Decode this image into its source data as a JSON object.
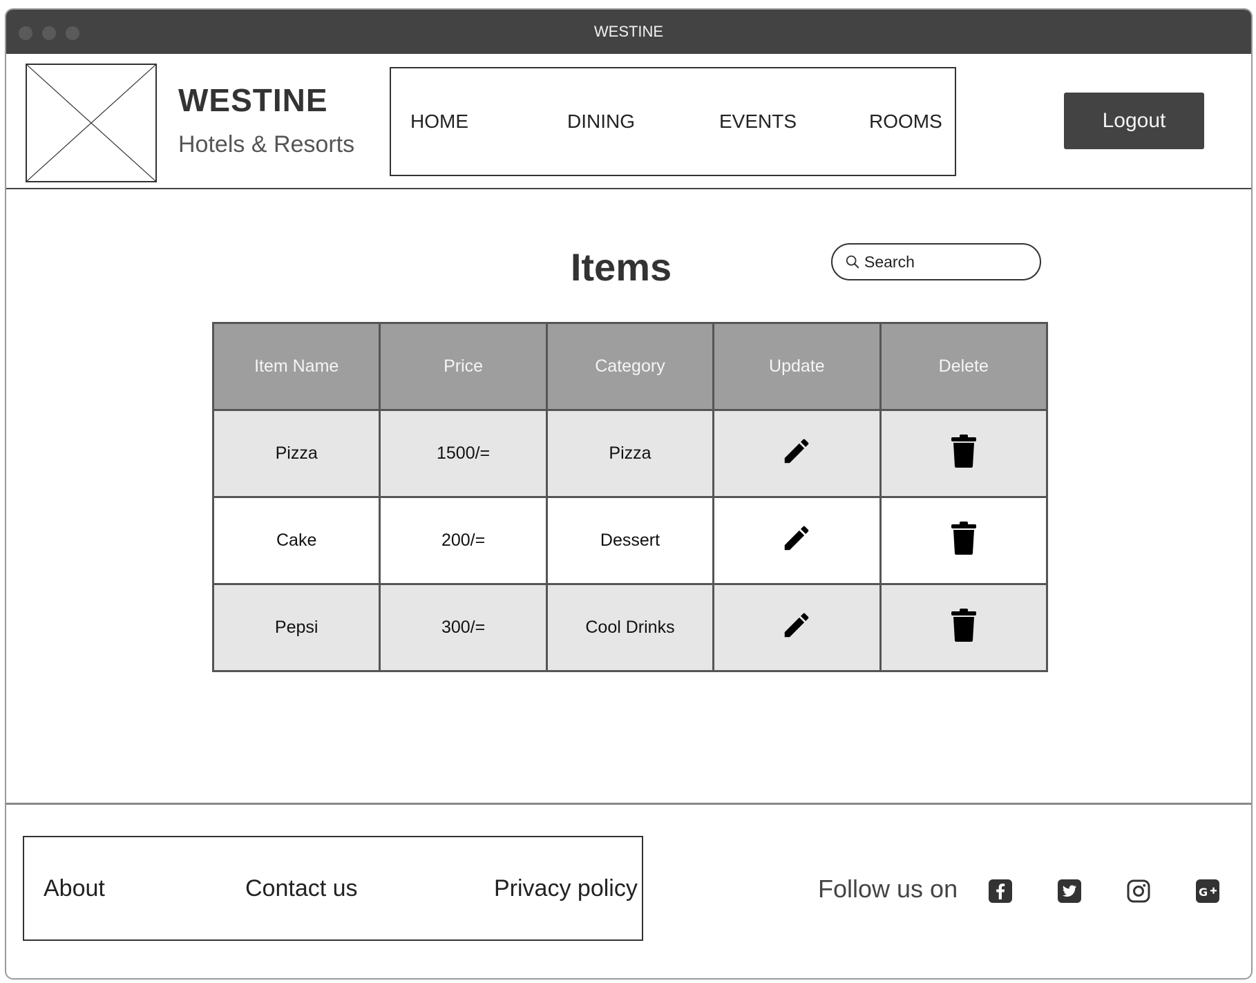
{
  "window": {
    "title": "WESTINE"
  },
  "brand": {
    "name": "WESTINE",
    "tagline": "Hotels & Resorts"
  },
  "nav": {
    "items": [
      {
        "label": "HOME"
      },
      {
        "label": "DINING"
      },
      {
        "label": "EVENTS"
      },
      {
        "label": "ROOMS"
      }
    ]
  },
  "header": {
    "logout_label": "Logout"
  },
  "main": {
    "title": "Items",
    "search": {
      "placeholder": "Search",
      "value": ""
    },
    "table": {
      "columns": [
        "Item Name",
        "Price",
        "Category",
        "Update",
        "Delete"
      ],
      "rows": [
        {
          "name": "Pizza",
          "price": "1500/=",
          "category": "Pizza"
        },
        {
          "name": "Cake",
          "price": "200/=",
          "category": "Dessert"
        },
        {
          "name": "Pepsi",
          "price": "300/=",
          "category": "Cool Drinks"
        }
      ],
      "update_icon": "pencil-icon",
      "delete_icon": "trash-icon"
    }
  },
  "footer": {
    "links": [
      {
        "label": "About"
      },
      {
        "label": "Contact us"
      },
      {
        "label": "Privacy policy"
      }
    ],
    "follow_label": "Follow us on",
    "social_icons": [
      "facebook-icon",
      "twitter-icon",
      "instagram-icon",
      "google-plus-icon"
    ]
  },
  "colors": {
    "titlebar": "#434343",
    "header_row": "#9e9e9e",
    "row_shaded": "#e6e6e6",
    "button": "#434343"
  }
}
